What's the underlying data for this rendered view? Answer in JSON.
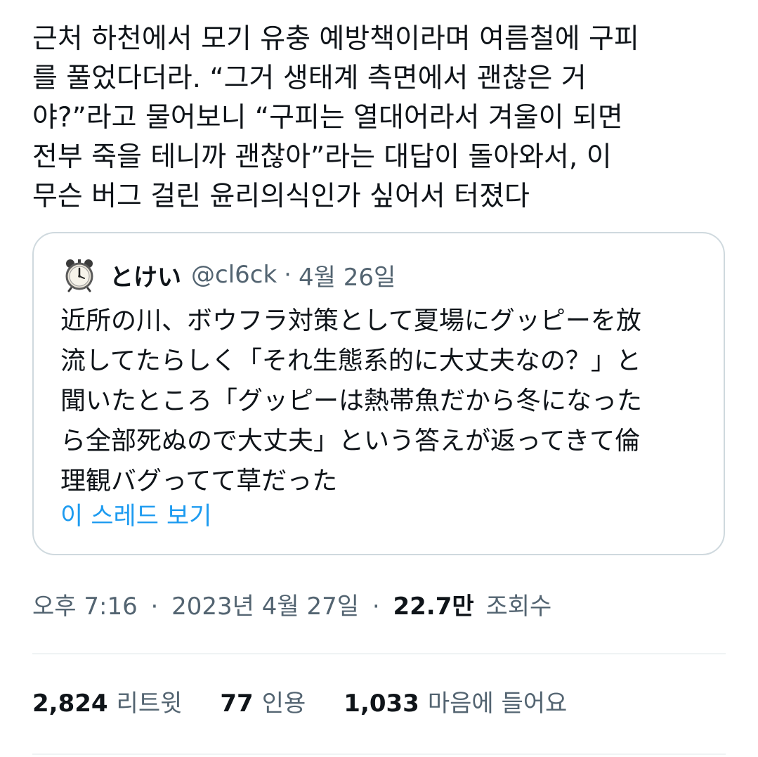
{
  "tweet": {
    "lines": [
      "근처 하천에서 모기 유충 예방책이라며 여름철에 구피",
      "를 풀었다더라. “그거 생태계 측면에서 괜찮은 거",
      "야?”라고 물어보니 “구피는 열대어라서 겨울이 되면",
      "전부 죽을 테니까 괜찮아”라는 대답이 돌아와서, 이",
      "무슨 버그 걸린 윤리의식인가 싶어서 터졌다"
    ]
  },
  "quote": {
    "avatar_icon": "alarm-clock-icon",
    "display_name": "とけい",
    "handle": "@cl6ck",
    "separator": "·",
    "date": "4월 26일",
    "lines": [
      "近所の川、ボウフラ対策として夏場にグッピーを放",
      "流してたらしく「それ生態系的に大丈夫なの？」と",
      "聞いたところ「グッピーは熱帯魚だから冬になった",
      "ら全部死ぬので大丈夫」という答えが返ってきて倫",
      "理観バグってて草だった"
    ],
    "show_thread": "이 스레드 보기"
  },
  "meta": {
    "time": "오후 7:16",
    "separator": "·",
    "date": "2023년 4월 27일",
    "views_count": "22.7만",
    "views_label": "조회수"
  },
  "stats": {
    "retweets_count": "2,824",
    "retweets_label": "리트윗",
    "quotes_count": "77",
    "quotes_label": "인용",
    "likes_count": "1,033",
    "likes_label": "마음에 들어요"
  },
  "colors": {
    "text": "#0f1419",
    "secondary": "#536471",
    "link": "#1d9bf0",
    "border": "#cfd9de",
    "divider": "#eff3f4"
  }
}
